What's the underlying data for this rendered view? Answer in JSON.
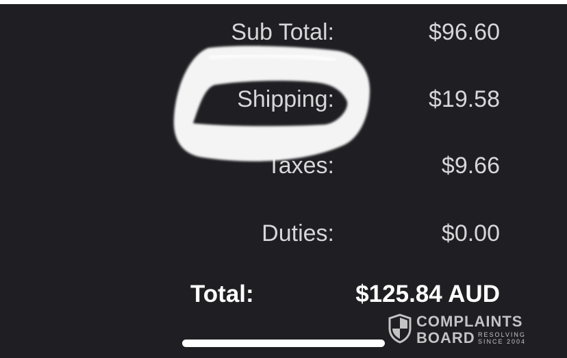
{
  "summary": {
    "rows": [
      {
        "label": "Sub Total:",
        "value": "$96.60"
      },
      {
        "label": "Shipping:",
        "value": "$19.58"
      },
      {
        "label": "Taxes:",
        "value": "$9.66"
      },
      {
        "label": "Duties:",
        "value": "$0.00"
      }
    ],
    "total": {
      "label": "Total:",
      "value": "$125.84 AUD"
    }
  },
  "watermark": {
    "line1": "COMPLAINTS",
    "line2": "BOARD",
    "tag1": "RESOLVING",
    "tag2": "SINCE 2004"
  },
  "colors": {
    "background": "#1f1f23",
    "text": "#d7d7da",
    "total_text": "#ffffff",
    "highlight": "#ffffff"
  },
  "icons": {
    "watermark_logo": "shield-icon"
  }
}
